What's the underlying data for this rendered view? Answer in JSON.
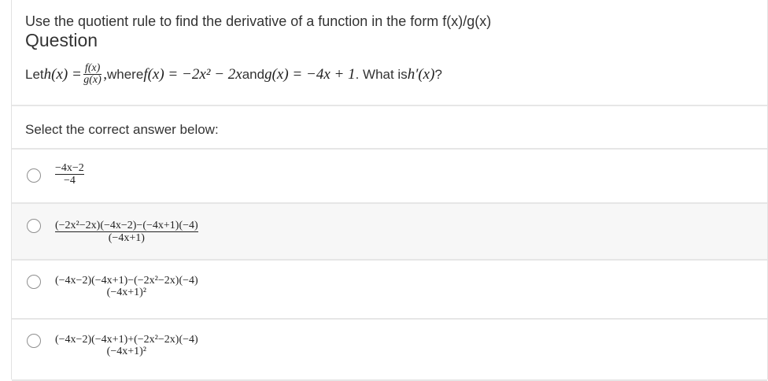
{
  "header": {
    "top_title": "Use the quotient rule to find the derivative of a function in the form f(x)/g(x)",
    "heading": "Question",
    "stem": {
      "let": "Let ",
      "h_of_x": "h(x) = ",
      "frac_num": "f(x)",
      "frac_den": "g(x)",
      "comma": ", ",
      "where": "where ",
      "f_def": "f(x) = −2x² − 2x",
      "and": " and ",
      "g_def": "g(x) = −4x + 1",
      "what_is": ". What is ",
      "hprime": "h′(x)",
      "qmark": "?"
    }
  },
  "prompt": {
    "select_label": "Select the correct answer below:"
  },
  "options": [
    {
      "num": "−4x−2",
      "den": "−4"
    },
    {
      "num": "(−2x²−2x)(−4x−2)−(−4x+1)(−4)",
      "den": "(−4x+1)"
    },
    {
      "num": "(−4x−2)(−4x+1)−(−2x²−2x)(−4)",
      "den": "(−4x+1)²"
    },
    {
      "num": "(−4x−2)(−4x+1)+(−2x²−2x)(−4)",
      "den": "(−4x+1)²"
    }
  ]
}
